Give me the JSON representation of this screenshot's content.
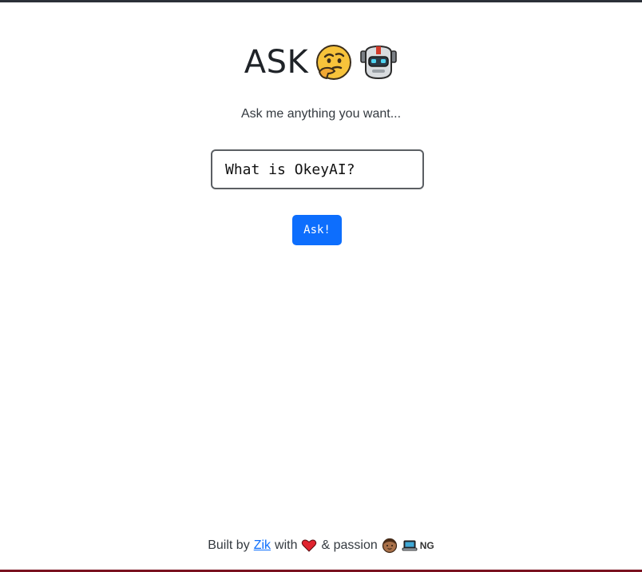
{
  "header": {
    "title": "ASK",
    "icons": [
      "thinking-face-icon",
      "robot-icon"
    ]
  },
  "subtitle": "Ask me anything you want...",
  "question_input": {
    "value": "What is OkeyAI?"
  },
  "ask_button": {
    "label": "Ask!",
    "color": "#0d6efd"
  },
  "footer": {
    "built_by": "Built by",
    "author": "Zik",
    "with": "with",
    "passion": "& passion",
    "country": "NG",
    "icons": [
      "heart-icon",
      "technologist-icon",
      "laptop-icon"
    ]
  }
}
